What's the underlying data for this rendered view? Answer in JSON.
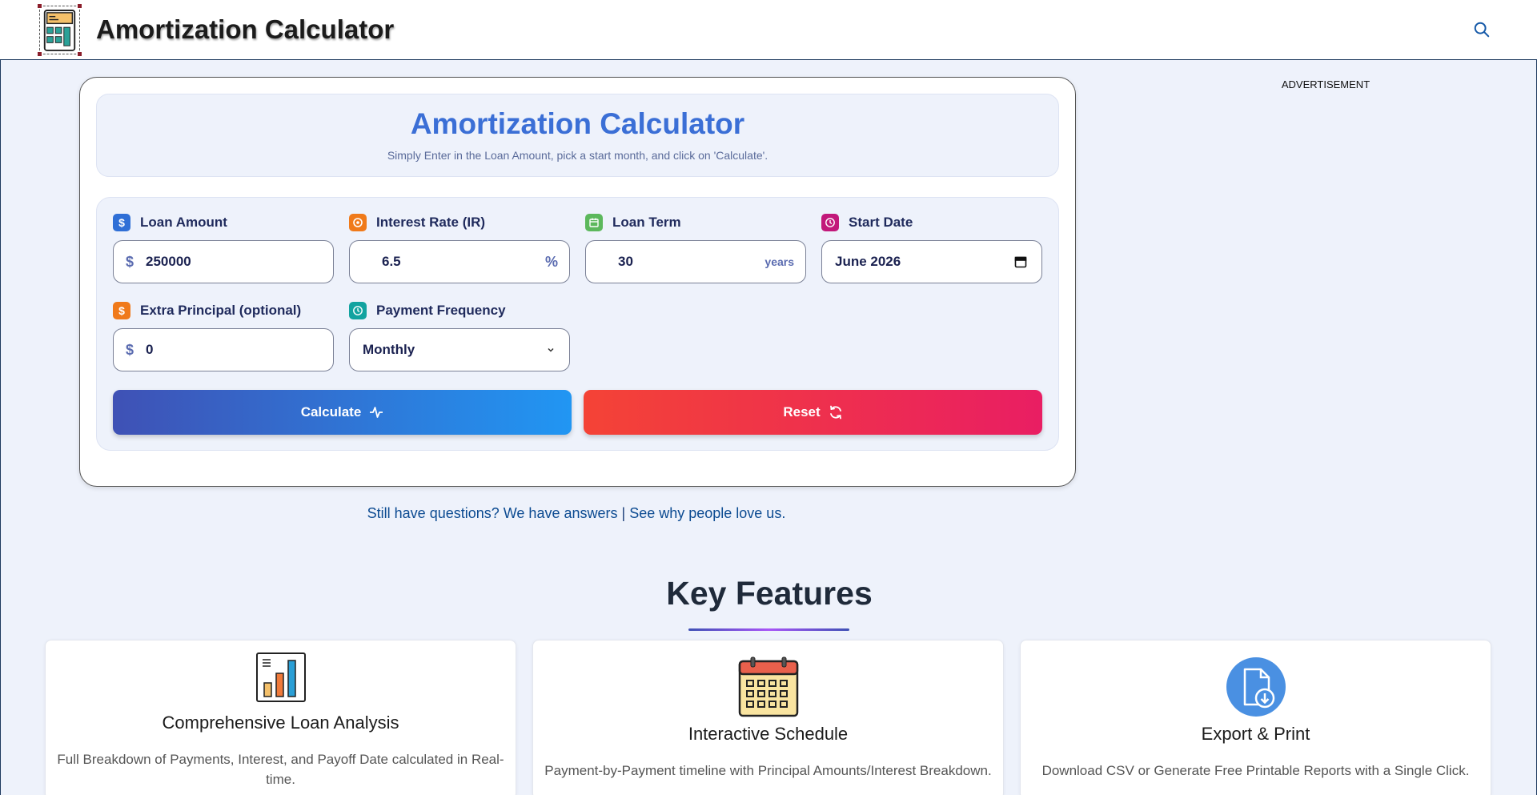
{
  "header": {
    "site_title": "Amortization Calculator",
    "icons": {
      "logo": "calculator-logo-icon",
      "search": "search-icon"
    }
  },
  "ad": {
    "label": "ADVERTISEMENT"
  },
  "calculator": {
    "title": "Amortization Calculator",
    "subtitle": "Simply Enter in the Loan Amount, pick a start month, and click on 'Calculate'.",
    "fields": {
      "loan_amount": {
        "label": "Loan Amount",
        "prefix": "$",
        "value": "250000",
        "icon": "dollar-icon",
        "icon_color": "#2f6fd6"
      },
      "interest_rate": {
        "label": "Interest Rate (IR)",
        "suffix": "%",
        "value": "6.5",
        "icon": "percent-circle-icon",
        "icon_color": "#f07a1a"
      },
      "loan_term": {
        "label": "Loan Term",
        "suffix": "years",
        "value": "30",
        "icon": "calendar-icon",
        "icon_color": "#5cb85c"
      },
      "start_date": {
        "label": "Start Date",
        "value": "June 2026",
        "icon": "clock-icon",
        "icon_color": "#c2187a"
      },
      "extra_principal": {
        "label": "Extra Principal (optional)",
        "prefix": "$",
        "value": "0",
        "icon": "dollar-icon",
        "icon_color": "#f07a1a"
      },
      "payment_frequency": {
        "label": "Payment Frequency",
        "value": "Monthly",
        "icon": "clock-icon",
        "icon_color": "#12a3a0"
      }
    },
    "buttons": {
      "calculate": "Calculate",
      "reset": "Reset"
    }
  },
  "questions": {
    "link1": "Still have questions? We have answers",
    "separator": " | ",
    "link2": "See why people love us."
  },
  "key_features": {
    "title": "Key Features",
    "cards": [
      {
        "title": "Comprehensive Loan Analysis",
        "desc": "Full Breakdown of Payments, Interest, and Payoff Date calculated in Real-time.",
        "icon": "bar-chart-icon"
      },
      {
        "title": "Interactive Schedule",
        "desc": "Payment-by-Payment timeline with Principal Amounts/Interest Breakdown.",
        "icon": "calendar-icon"
      },
      {
        "title": "Export & Print",
        "desc": "Download CSV or Generate Free Printable Reports with a Single Click.",
        "icon": "file-download-icon"
      }
    ]
  },
  "colors": {
    "accent_title": "#3b6fd6",
    "calculate_gradient": [
      "#3f51b5",
      "#2196f3"
    ],
    "reset_gradient": [
      "#f44336",
      "#e91e63"
    ]
  }
}
